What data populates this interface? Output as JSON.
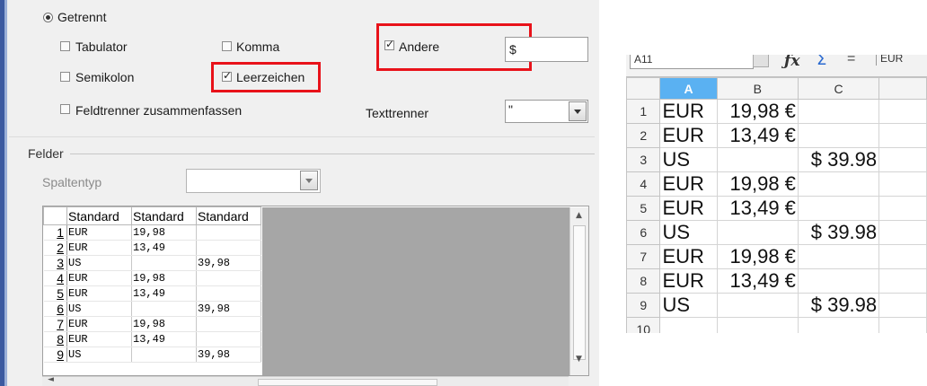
{
  "dialog": {
    "separator_option": "Getrennt",
    "options": {
      "tabulator": {
        "label": "Tabulator",
        "checked": false
      },
      "komma": {
        "label": "Komma",
        "checked": false
      },
      "andere": {
        "label": "Andere",
        "checked": true,
        "value": "$"
      },
      "semikolon": {
        "label": "Semikolon",
        "checked": false
      },
      "leerzeichen": {
        "label": "Leerzeichen",
        "checked": true
      },
      "zusammenfassen": {
        "label": "Feldtrenner zusammenfassen",
        "checked": false
      }
    },
    "texttrenner": {
      "label": "Texttrenner",
      "value": "\""
    },
    "felder": {
      "title": "Felder",
      "spaltentyp_label": "Spaltentyp",
      "spaltentyp_value": "",
      "headers": [
        "Standard",
        "Standard",
        "Standard"
      ],
      "rows": [
        {
          "n": "1",
          "cells": [
            "EUR",
            "19,98",
            ""
          ]
        },
        {
          "n": "2",
          "cells": [
            "EUR",
            "13,49",
            ""
          ]
        },
        {
          "n": "3",
          "cells": [
            "US",
            "",
            "39,98"
          ]
        },
        {
          "n": "4",
          "cells": [
            "EUR",
            "19,98",
            ""
          ]
        },
        {
          "n": "5",
          "cells": [
            "EUR",
            "13,49",
            ""
          ]
        },
        {
          "n": "6",
          "cells": [
            "US",
            "",
            "39,98"
          ]
        },
        {
          "n": "7",
          "cells": [
            "EUR",
            "19,98",
            ""
          ]
        },
        {
          "n": "8",
          "cells": [
            "EUR",
            "13,49",
            ""
          ]
        },
        {
          "n": "9",
          "cells": [
            "US",
            "",
            "39,98"
          ]
        }
      ]
    }
  },
  "spreadsheet": {
    "name_box": "A11",
    "formula_icons": [
      "fx-icon",
      "sum-icon",
      "equals-icon"
    ],
    "formula_text": "EUR",
    "columns": [
      "A",
      "B",
      "C"
    ],
    "selected_column": "A",
    "rows": [
      {
        "n": "1",
        "a": "EUR",
        "b": "19,98 €",
        "c": ""
      },
      {
        "n": "2",
        "a": "EUR",
        "b": "13,49 €",
        "c": ""
      },
      {
        "n": "3",
        "a": "US",
        "b": "",
        "c": "$ 39.98"
      },
      {
        "n": "4",
        "a": "EUR",
        "b": "19,98 €",
        "c": ""
      },
      {
        "n": "5",
        "a": "EUR",
        "b": "13,49 €",
        "c": ""
      },
      {
        "n": "6",
        "a": "US",
        "b": "",
        "c": "$ 39.98"
      },
      {
        "n": "7",
        "a": "EUR",
        "b": "19,98 €",
        "c": ""
      },
      {
        "n": "8",
        "a": "EUR",
        "b": "13,49 €",
        "c": ""
      },
      {
        "n": "9",
        "a": "US",
        "b": "",
        "c": "$ 39.98"
      },
      {
        "n": "10",
        "a": "",
        "b": "",
        "c": ""
      }
    ]
  },
  "colors": {
    "highlight": "#e8121a",
    "selected_column": "#5ab1f2",
    "preview_gray": "#a6a6a6"
  }
}
